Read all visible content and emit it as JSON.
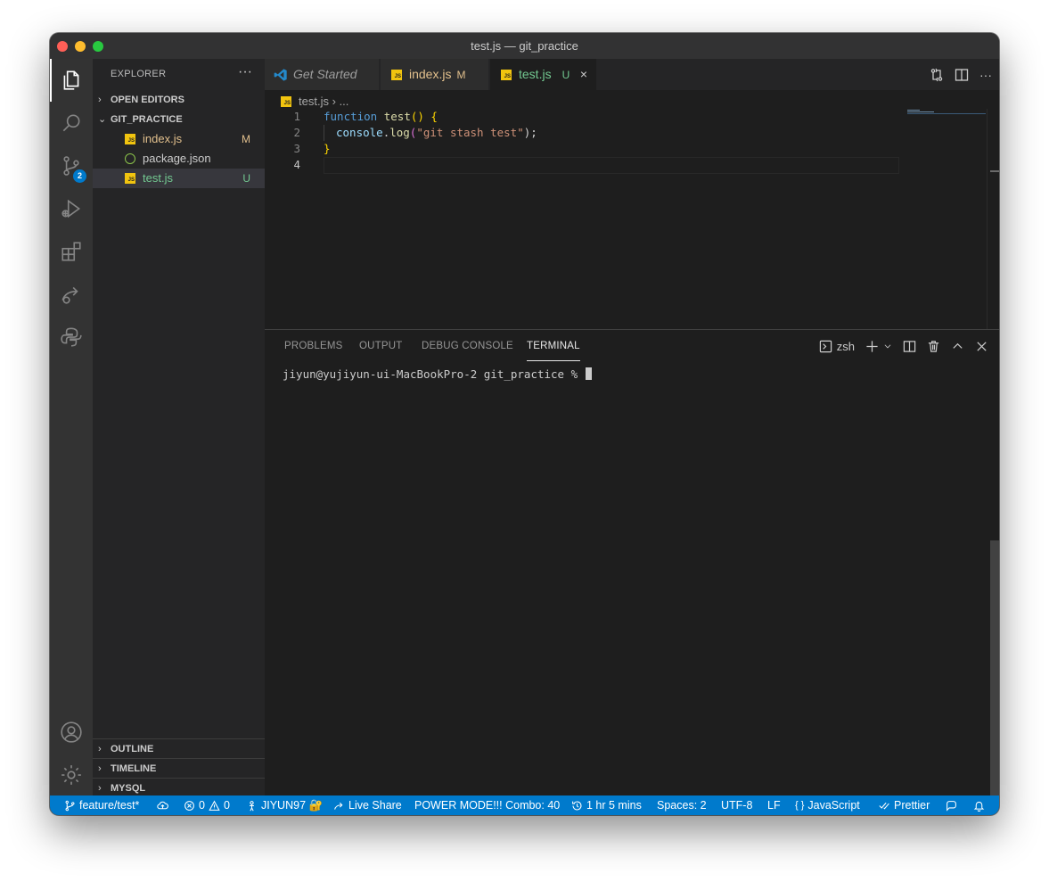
{
  "window": {
    "title": "test.js — git_practice"
  },
  "activity_bar": {
    "items": [
      {
        "name": "explorer-icon",
        "active": true
      },
      {
        "name": "search-icon"
      },
      {
        "name": "source-control-icon",
        "badge": "2"
      },
      {
        "name": "run-debug-icon"
      },
      {
        "name": "extensions-icon"
      },
      {
        "name": "live-share-icon"
      },
      {
        "name": "python-icon"
      }
    ],
    "bottom": [
      "accounts-icon",
      "settings-gear-icon"
    ]
  },
  "sidebar": {
    "title": "EXPLORER",
    "more": "···",
    "sections": {
      "open_editors": "OPEN EDITORS",
      "folder": "GIT_PRACTICE",
      "outline": "OUTLINE",
      "timeline": "TIMELINE",
      "mysql": "MYSQL"
    },
    "files": [
      {
        "name": "index.js",
        "status": "M",
        "icon": "js-file-icon"
      },
      {
        "name": "package.json",
        "status": "",
        "icon": "json-file-icon"
      },
      {
        "name": "test.js",
        "status": "U",
        "icon": "js-file-icon"
      }
    ]
  },
  "tabs": [
    {
      "label": "Get Started",
      "status": ""
    },
    {
      "label": "index.js",
      "status": "M"
    },
    {
      "label": "test.js",
      "status": "U",
      "close": "×"
    }
  ],
  "breadcrumb": {
    "file": "test.js",
    "sep": "›",
    "rest": "..."
  },
  "code": {
    "line_numbers": [
      "1",
      "2",
      "3",
      "4"
    ],
    "line1": {
      "kw": "function",
      "fn": "test",
      "br": "() {"
    },
    "line2": {
      "obj": "console",
      "dot": ".",
      "method": "log",
      "open": "(",
      "str": "\"git stash test\"",
      "close": ");"
    },
    "line3": {
      "br": "}"
    }
  },
  "panel": {
    "tabs": [
      "PROBLEMS",
      "OUTPUT",
      "DEBUG CONSOLE",
      "TERMINAL"
    ],
    "active_tab": "TERMINAL",
    "shell": "zsh",
    "terminal_prompt": "jiyun@yujiyun-ui-MacBookPro-2 git_practice % "
  },
  "status_bar": {
    "branch": "feature/test*",
    "errors": "0",
    "warnings": "0",
    "user": "JIYUN97 🔐",
    "live_share": "Live Share",
    "power_mode": "POWER MODE!!! Combo: 40",
    "time": "1 hr 5 mins",
    "spaces": "Spaces: 2",
    "encoding": "UTF-8",
    "eol": "LF",
    "language": "JavaScript",
    "formatter": "Prettier"
  },
  "colors": {
    "accent": "#007acc",
    "modified": "#e2c08d",
    "untracked": "#73c991"
  }
}
